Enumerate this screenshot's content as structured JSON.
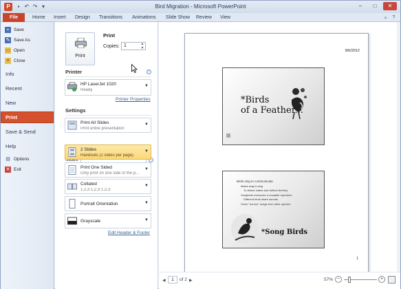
{
  "window": {
    "title": "Bird Migration - Microsoft PowerPoint",
    "app_icon": "P",
    "qat_icons": [
      "save-icon",
      "undo-icon",
      "redo-icon",
      "customize-icon"
    ],
    "controls": {
      "minimize": "–",
      "maximize": "□",
      "close": "✕"
    }
  },
  "ribbon": {
    "file_tab": "File",
    "tabs": [
      "Home",
      "Insert",
      "Design",
      "Transitions",
      "Animations",
      "Slide Show",
      "Review",
      "View"
    ]
  },
  "nav": {
    "small_items": [
      {
        "label": "Save",
        "icon": "save-icon"
      },
      {
        "label": "Save As",
        "icon": "save-as-icon"
      },
      {
        "label": "Open",
        "icon": "open-folder-icon"
      },
      {
        "label": "Close",
        "icon": "close-file-icon"
      }
    ],
    "big_items": [
      "Info",
      "Recent",
      "New",
      "Print",
      "Save & Send",
      "Help"
    ],
    "bottom_items": [
      {
        "label": "Options",
        "icon": "options-icon"
      },
      {
        "label": "Exit",
        "icon": "exit-icon"
      }
    ],
    "selected": "Print"
  },
  "print": {
    "heading": "Print",
    "button_label": "Print",
    "copies_label": "Copies:",
    "copies_value": "1",
    "printer_heading": "Printer",
    "printer_name": "HP LaserJet 1020",
    "printer_status": "Ready",
    "printer_properties": "Printer Properties",
    "settings_heading": "Settings",
    "settings": [
      {
        "id": "range",
        "line1": "Print All Slides",
        "line2": "Print entire presentation"
      },
      {
        "id": "layout",
        "line1": "2 Slides",
        "line2": "Handouts (2 slides per page)",
        "selected": true
      },
      {
        "id": "sides",
        "line1": "Print One Sided",
        "line2": "Only print on one side of the p..."
      },
      {
        "id": "collate",
        "line1": "Collated",
        "line2": "1,2,3    1,2,3    1,2,3"
      },
      {
        "id": "orientation",
        "line1": "Portrait Orientation",
        "line2": ""
      },
      {
        "id": "color",
        "line1": "Grayscale",
        "line2": ""
      }
    ],
    "slides_label": "Slides:",
    "edit_header_footer": "Edit Header & Footer"
  },
  "preview": {
    "date": "9/6/2012",
    "page_number": "1",
    "slide1": {
      "title_line1": "*Birds",
      "title_line2": "of a Feather..."
    },
    "slide2": {
      "bullets": [
        "Birds sing to communicate",
        "Males sing to sing",
        "To attract mates and defend territory",
        "Songbirds memorize a reusable repertoire",
        "Different birds share sounds",
        "Some \"borrow\" songs from other species"
      ],
      "title": "*Song Birds"
    },
    "nav": {
      "current_page": "1",
      "of_label": "of 2",
      "prev": "◀",
      "next": "▶"
    },
    "zoom": {
      "percent": "57%",
      "level": 0.57
    }
  }
}
